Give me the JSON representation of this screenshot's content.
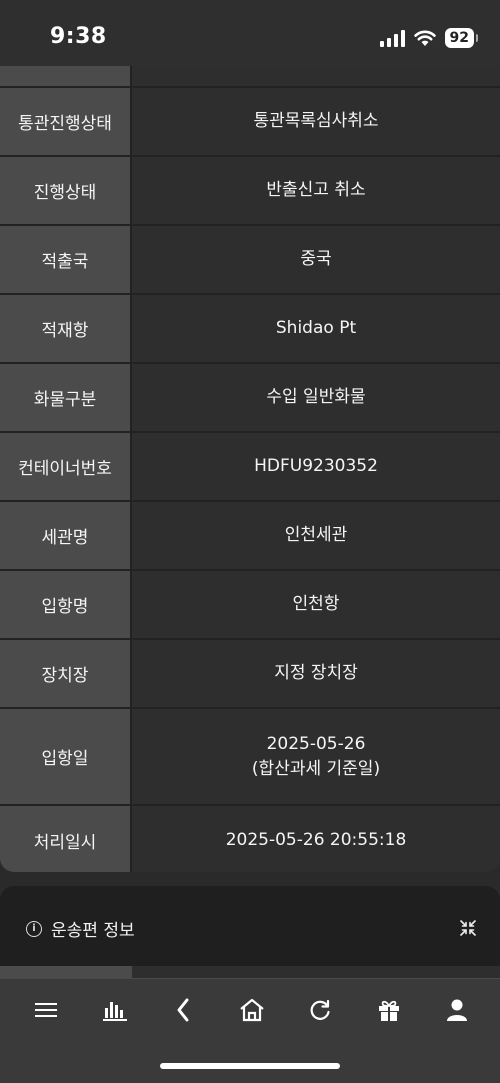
{
  "status_bar": {
    "time": "9:38",
    "battery": "92"
  },
  "rows": [
    {
      "label": "통관진행상태",
      "value": "통관목록심사취소"
    },
    {
      "label": "진행상태",
      "value": "반출신고 취소"
    },
    {
      "label": "적출국",
      "value": "중국"
    },
    {
      "label": "적재항",
      "value": "Shidao Pt"
    },
    {
      "label": "화물구분",
      "value": "수입 일반화물"
    },
    {
      "label": "컨테이너번호",
      "value": "HDFU9230352"
    },
    {
      "label": "세관명",
      "value": "인천세관"
    },
    {
      "label": "입항명",
      "value": "인천항"
    },
    {
      "label": "장치장",
      "value": "지정 장치장"
    },
    {
      "label": "입항일",
      "value": "2025-05-26",
      "value_line2": "(합산과세 기준일)"
    },
    {
      "label": "처리일시",
      "value": "2025-05-26 20:55:18"
    }
  ],
  "section": {
    "title": "운송편 정보",
    "info_icon": "info-icon",
    "toggle_icon": "collapse-icon"
  },
  "bottom_nav": [
    {
      "name": "menu-icon"
    },
    {
      "name": "chart-icon"
    },
    {
      "name": "back-icon"
    },
    {
      "name": "home-icon"
    },
    {
      "name": "refresh-icon"
    },
    {
      "name": "gift-icon"
    },
    {
      "name": "user-icon"
    }
  ],
  "colors": {
    "label_bg": "#4b4b4b",
    "value_bg": "#2e2e2e",
    "divider": "#222222",
    "nav_bg": "#3a3a3a"
  }
}
